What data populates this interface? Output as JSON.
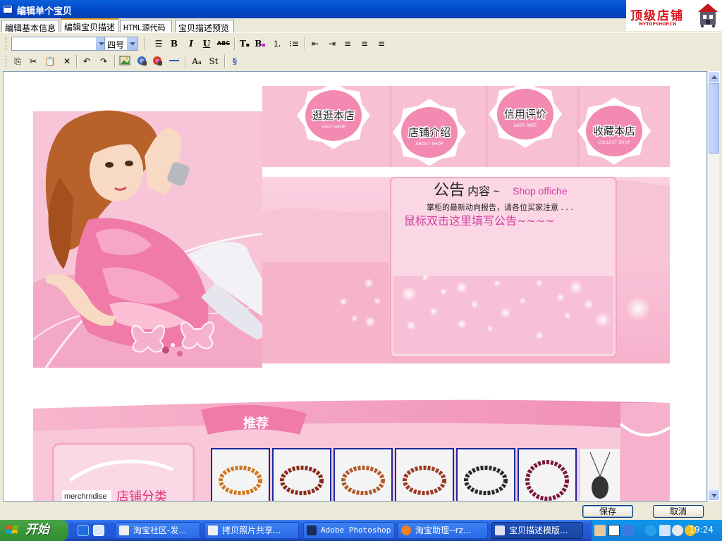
{
  "window": {
    "title": "编辑单个宝贝",
    "logo_text": "顶级店铺",
    "logo_sub": "MYTOPSHOP.CN"
  },
  "tabs": [
    {
      "label": "编辑基本信息",
      "active": false
    },
    {
      "label": "编辑宝贝描述",
      "active": true
    },
    {
      "label": "HTML源代码",
      "active": false
    },
    {
      "label": "宝贝描述预览",
      "active": false
    }
  ],
  "toolbar": {
    "font_name_value": "",
    "font_size_value": "四号",
    "buttons_row1": [
      "list-bullets",
      "bold",
      "italic",
      "underline",
      "strikethrough",
      "text-color",
      "background-color",
      "numbered-list",
      "bullet-list",
      "outdent",
      "indent",
      "align-left",
      "align-center",
      "align-right"
    ],
    "buttons_row2": [
      "copy",
      "cut",
      "paste",
      "delete",
      "undo",
      "redo",
      "insert-image",
      "insert-flash",
      "insert-media",
      "horizontal-rule",
      "text-style",
      "strikeout-style",
      "insert-link"
    ],
    "bold": "B",
    "italic": "I",
    "underline": "U",
    "strike": "ABC",
    "textstyle": "A",
    "strikeout": "St"
  },
  "banner": {
    "nav": [
      {
        "label": "逛逛本店",
        "sub": "VISIT SHOP"
      },
      {
        "label": "店铺介绍",
        "sub": "ABOUT SHOP"
      },
      {
        "label": "信用评价",
        "sub": "USER RATE"
      },
      {
        "label": "收藏本店",
        "sub": "COLLECT SHOP"
      }
    ],
    "notice_title": "公告",
    "notice_title2": "内容 ~",
    "notice_en": "Shop offiche",
    "notice_line1": "掌柜的最新动向报告，请各位买家注意 . . .",
    "notice_line2": "鼠标双击这里填写公告~~~~",
    "recommend_label": "推荐",
    "category_en": "merchrndise",
    "category_cn": "店铺分类"
  },
  "buttons": {
    "save": "保存",
    "cancel": "取消"
  },
  "taskbar": {
    "start": "开始",
    "tasks": [
      "淘宝社区-发...",
      "拷贝照片共享...",
      "Adobe Photoshop",
      "淘宝助理--rz...",
      "宝贝描述模版..."
    ],
    "clock": "19:24"
  },
  "colors": {
    "pink_light": "#fcd6e4",
    "pink_mid": "#f4a6c4",
    "pink_deep": "#e86a9a",
    "notice_text": "#d040a0",
    "xp_blue": "#245edb"
  }
}
